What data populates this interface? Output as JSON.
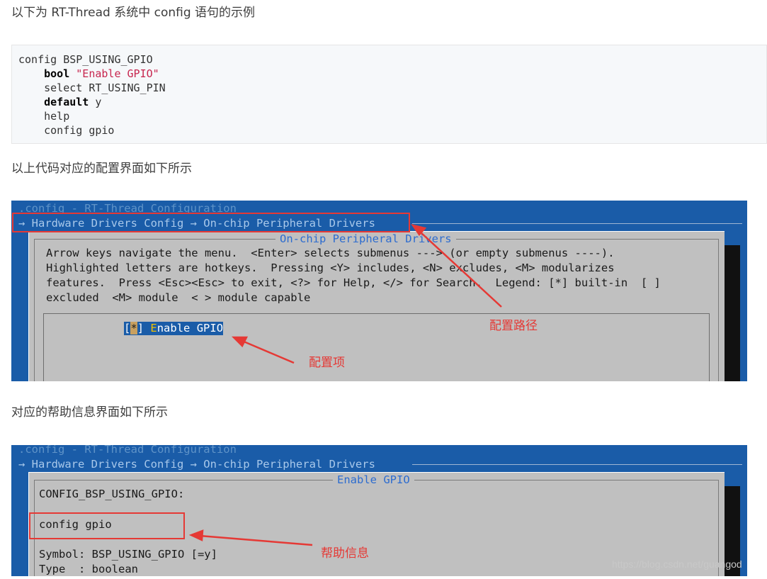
{
  "article": {
    "intro": "以下为 RT-Thread 系统中 config 语句的示例",
    "code": {
      "line1": "config BSP_USING_GPIO",
      "line2_kw": "bool",
      "line2_str": "\"Enable GPIO\"",
      "line3": "select RT_USING_PIN",
      "line4_kw": "default",
      "line4_rest": " y",
      "line5": "help",
      "line6": "config gpio"
    },
    "caption1": "以上代码对应的配置界面如下所示",
    "caption2": "对应的帮助信息界面如下所示"
  },
  "screen1": {
    "title": ".config - RT-Thread Configuration",
    "path": "→ Hardware Drivers Config → On-chip Peripheral Drivers",
    "dialog_title": "On-chip Peripheral Drivers",
    "help_lines": [
      "Arrow keys navigate the menu.  <Enter> selects submenus ---> (or empty submenus ----).",
      "Highlighted letters are hotkeys.  Pressing <Y> includes, <N> excludes, <M> modularizes",
      "features.  Press <Esc><Esc> to exit, <?> for Help, </> for Search.  Legend: [*] built-in  [ ]",
      "excluded  <M> module  < > module capable"
    ],
    "item_open": "[",
    "item_mark": "*",
    "item_close": "] ",
    "item_hot": "E",
    "item_rest": "nable GPIO",
    "anno_path": "配置路径",
    "anno_item": "配置项"
  },
  "screen2": {
    "title": ".config - RT-Thread Configuration",
    "path": "→ Hardware Drivers Config → On-chip Peripheral Drivers",
    "dialog_title": "Enable GPIO",
    "config_name": "CONFIG_BSP_USING_GPIO:",
    "help_text": "config gpio",
    "symbol_line": "Symbol: BSP_USING_GPIO [=y]",
    "type_line": "Type  : boolean",
    "anno_help": "帮助信息"
  },
  "watermark": "https://blog.csdn.net/guangod",
  "colors": {
    "terminal_bg": "#1a5ca8",
    "dialog_bg": "#c0c0c0",
    "annotation_red": "#e53935"
  }
}
